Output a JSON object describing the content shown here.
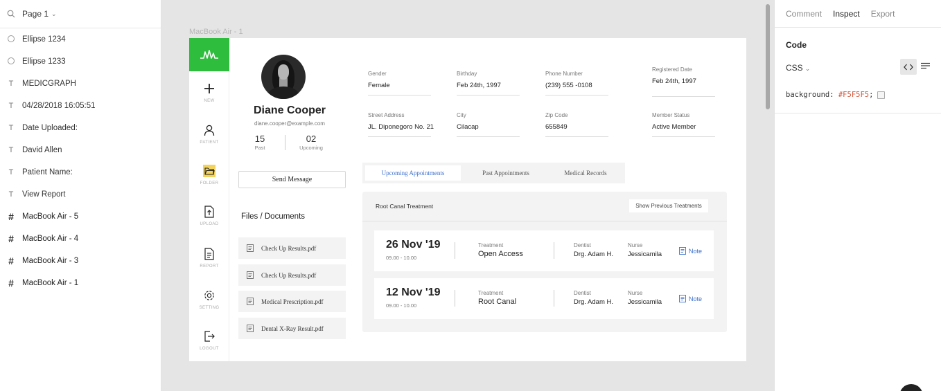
{
  "layers_panel": {
    "page_name": "Page 1",
    "items": [
      {
        "type": "ellipse",
        "label": "Ellipse 1234"
      },
      {
        "type": "ellipse",
        "label": "Ellipse 1233"
      },
      {
        "type": "text",
        "label": "MEDICGRAPH"
      },
      {
        "type": "text",
        "label": "04/28/2018 16:05:51"
      },
      {
        "type": "text",
        "label": "Date Uploaded:"
      },
      {
        "type": "text",
        "label": "David Allen"
      },
      {
        "type": "text",
        "label": "Patient Name:"
      },
      {
        "type": "text",
        "label": "View Report"
      },
      {
        "type": "frame",
        "label": "MacBook Air - 5"
      },
      {
        "type": "frame",
        "label": "MacBook Air - 4"
      },
      {
        "type": "frame",
        "label": "MacBook Air - 3"
      },
      {
        "type": "frame",
        "label": "MacBook Air - 1"
      }
    ]
  },
  "canvas": {
    "frame_label": "MacBook Air - 1"
  },
  "app": {
    "brand_color": "#2EBD3D",
    "accent_color": "#3B6ECC",
    "nav": [
      {
        "label": "NEW",
        "icon": "plus-icon"
      },
      {
        "label": "PATIENT",
        "icon": "user-icon"
      },
      {
        "label": "FOLDER",
        "icon": "folder-icon"
      },
      {
        "label": "UPLOAD",
        "icon": "upload-icon"
      },
      {
        "label": "REPORT",
        "icon": "report-icon"
      },
      {
        "label": "SETTING",
        "icon": "gear-icon"
      },
      {
        "label": "LOGOUT",
        "icon": "logout-icon"
      }
    ],
    "profile": {
      "name": "Diane Cooper",
      "email": "diane.cooper@example.com",
      "past_count": "15",
      "past_label": "Past",
      "upcoming_count": "02",
      "upcoming_label": "Upcoming",
      "send_message": "Send Message"
    },
    "files": {
      "title": "Files / Documents",
      "items": [
        "Check Up Results.pdf",
        "Check Up Results.pdf",
        "Medical Prescription.pdf",
        "Dental X-Ray Result.pdf"
      ]
    },
    "info": [
      {
        "key": "Gender",
        "value": "Female"
      },
      {
        "key": "Birthday",
        "value": "Feb 24th, 1997"
      },
      {
        "key": "Phone Number",
        "value": "(239) 555 -0108"
      },
      {
        "key": "Registered Date",
        "value": "Feb 24th, 1997"
      },
      {
        "key": "Street Address",
        "value": "JL. Diponegoro No. 21"
      },
      {
        "key": "City",
        "value": "Cilacap"
      },
      {
        "key": "Zip Code",
        "value": "655849"
      },
      {
        "key": "Member Status",
        "value": "Active Member"
      }
    ],
    "tabs": [
      "Upcoming Appointments",
      "Past Appointments",
      "Medical Records"
    ],
    "appointments": {
      "heading": "Root Canal Treatment",
      "show_previous": "Show Previous Treatments",
      "cards": [
        {
          "date": "26 Nov '19",
          "time": "09.00 - 10.00",
          "treatment_label": "Treatment",
          "treatment": "Open Access",
          "dentist_label": "Dentist",
          "dentist": "Drg. Adam H.",
          "nurse_label": "Nurse",
          "nurse": "Jessicamila",
          "note": "Note"
        },
        {
          "date": "12 Nov '19",
          "time": "09.00 - 10.00",
          "treatment_label": "Treatment",
          "treatment": "Root Canal",
          "dentist_label": "Dentist",
          "dentist": "Drg. Adam H.",
          "nurse_label": "Nurse",
          "nurse": "Jessicamila",
          "note": "Note"
        }
      ]
    }
  },
  "inspect_panel": {
    "tabs": [
      "Comment",
      "Inspect",
      "Export"
    ],
    "active_tab": "Inspect",
    "section_title": "Code",
    "language": "CSS",
    "code_property": "background: ",
    "code_value": "#F5F5F5",
    "code_suffix": ";"
  }
}
